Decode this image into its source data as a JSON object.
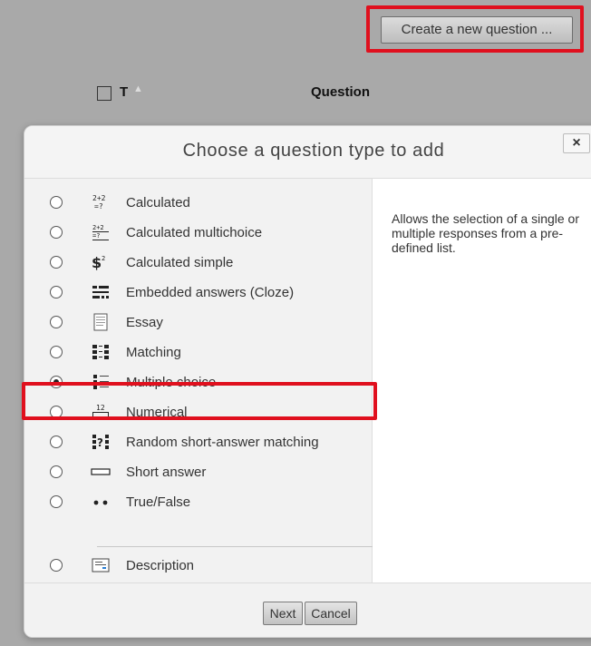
{
  "page": {
    "create_button_label": "Create a new question ...",
    "table_header": {
      "type_col": "T",
      "question_col": "Question"
    }
  },
  "dialog": {
    "title": "Choose a question type to add",
    "close_label": "×",
    "summary": "Allows the selection of a single or multiple responses from a pre-defined list.",
    "options": [
      {
        "label": "Calculated",
        "icon": "calculated-icon",
        "checked": false
      },
      {
        "label": "Calculated multichoice",
        "icon": "calculated-multichoice-icon",
        "checked": false
      },
      {
        "label": "Calculated simple",
        "icon": "calculated-simple-icon",
        "checked": false
      },
      {
        "label": "Embedded answers (Cloze)",
        "icon": "cloze-icon",
        "checked": false
      },
      {
        "label": "Essay",
        "icon": "essay-icon",
        "checked": false
      },
      {
        "label": "Matching",
        "icon": "matching-icon",
        "checked": false
      },
      {
        "label": "Multiple choice",
        "icon": "multiple-choice-icon",
        "checked": true
      },
      {
        "label": "Numerical",
        "icon": "numerical-icon",
        "checked": false
      },
      {
        "label": "Random short-answer matching",
        "icon": "random-matching-icon",
        "checked": false
      },
      {
        "label": "Short answer",
        "icon": "short-answer-icon",
        "checked": false
      },
      {
        "label": "True/False",
        "icon": "true-false-icon",
        "checked": false
      },
      {
        "label": "Description",
        "icon": "description-icon",
        "checked": false
      }
    ],
    "next_label": "Next",
    "cancel_label": "Cancel"
  },
  "colors": {
    "highlight": "#e0101e",
    "overlay": "#a9a9a9"
  }
}
